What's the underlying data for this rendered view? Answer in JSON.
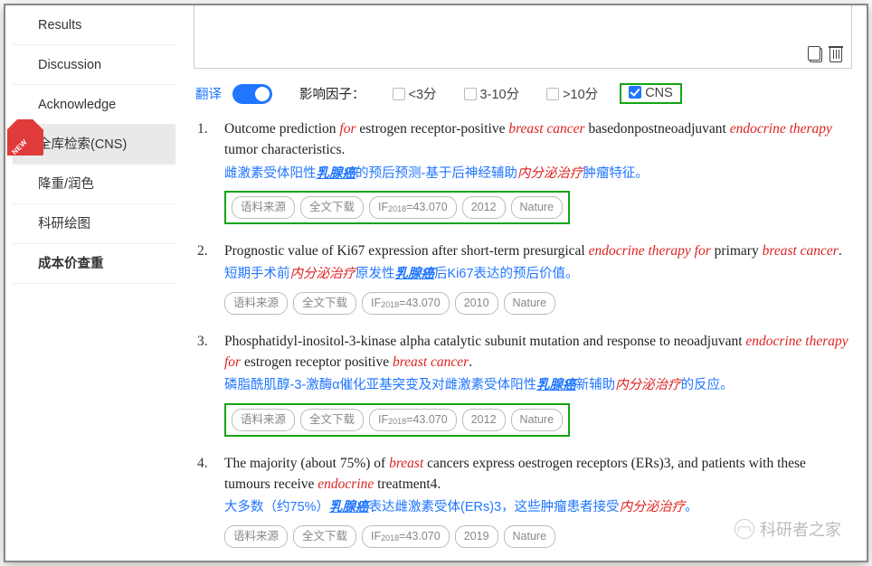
{
  "sidebar": {
    "items": [
      {
        "label": "Results"
      },
      {
        "label": "Discussion"
      },
      {
        "label": "Acknowledge"
      },
      {
        "label": "全库检索(CNS)"
      },
      {
        "label": "降重/润色"
      },
      {
        "label": "科研绘图"
      },
      {
        "label": "成本价查重"
      }
    ]
  },
  "filters": {
    "translate": "翻译",
    "impact": "影响因子：",
    "opts": [
      "<3分",
      "3-10分",
      ">10分",
      "CNS"
    ]
  },
  "results": [
    {
      "num": "1.",
      "en_parts": [
        "Outcome prediction ",
        "for",
        " estrogen receptor-positive ",
        "breast cancer",
        " basedonpostneoadjuvant ",
        "endocrine therapy",
        " tumor characteristics."
      ],
      "zh": "雌激素受体阳性<bi>乳腺癌</bi>的预后预测-基于后神经辅助<ri>内分泌治疗</ri>肿瘤特征。",
      "pills": [
        "语料来源",
        "全文下载",
        "IF2018=43.070",
        "2012",
        "Nature"
      ],
      "boxed": true
    },
    {
      "num": "2.",
      "en_parts": [
        "Prognostic value of Ki67 expression after short-term presurgical ",
        "endocrine therapy for",
        " primary ",
        "breast cancer",
        "."
      ],
      "zh": "短期手术前<ri>内分泌治疗</ri>原发性<bi>乳腺癌</bi>后Ki67表达的预后价值。",
      "pills": [
        "语料来源",
        "全文下载",
        "IF2018=43.070",
        "2010",
        "Nature"
      ],
      "boxed": false
    },
    {
      "num": "3.",
      "en_parts": [
        "Phosphatidyl-inositol-3-kinase alpha catalytic subunit mutation and response to neoadjuvant ",
        "endocrine therapy for",
        " estrogen receptor positive ",
        "breast cancer",
        "."
      ],
      "zh": "磷脂酰肌醇-3-激酶α催化亚基突变及对雌激素受体阳性<bi>乳腺癌</bi>新辅助<ri>内分泌治疗</ri>的反应。",
      "pills": [
        "语料来源",
        "全文下载",
        "IF2018=43.070",
        "2012",
        "Nature"
      ],
      "boxed": true
    },
    {
      "num": "4.",
      "en_parts": [
        "The majority (about 75%) of ",
        "breast",
        " cancers express oestrogen receptors (ERs)3, and patients with these tumours receive ",
        "endocrine",
        " treatment4."
      ],
      "zh": "大多数（约75%）<bi>乳腺癌</bi>表达雌激素受体(ERs)3，这些肿瘤患者接受<ri>内分泌治疗</ri>。",
      "pills": [
        "语料来源",
        "全文下载",
        "IF2018=43.070",
        "2019",
        "Nature"
      ],
      "boxed": false
    }
  ],
  "watermark": "科研者之家"
}
